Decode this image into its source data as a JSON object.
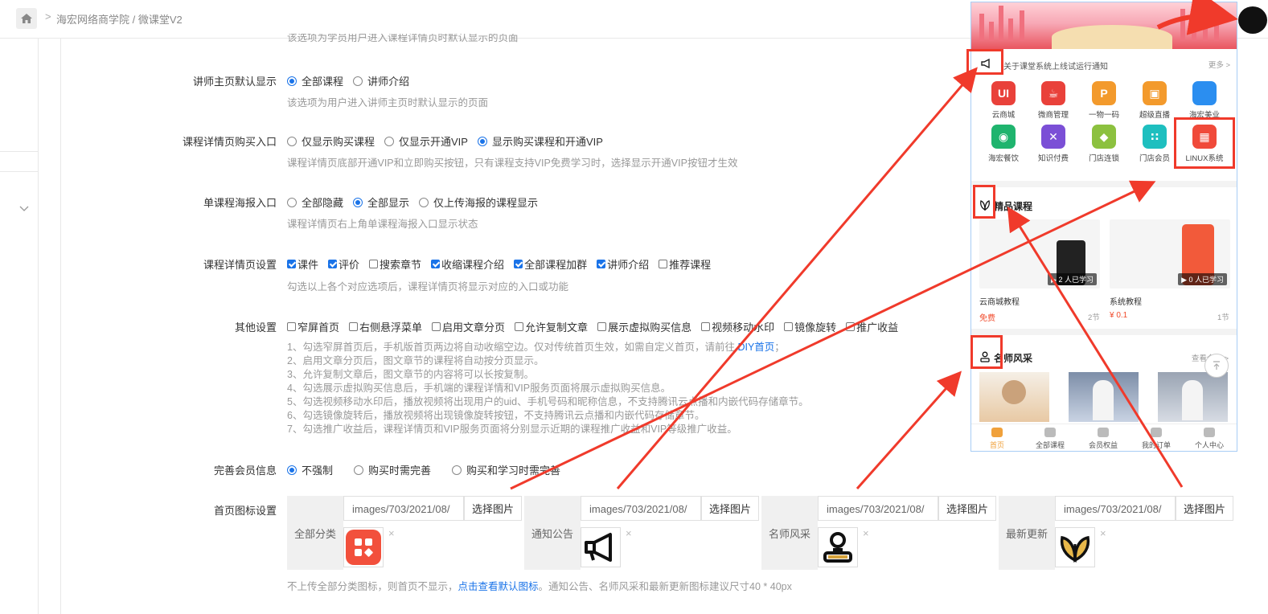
{
  "breadcrumb": "海宏网络商学院 / 微课堂V2",
  "top_hint": "该选项为学员用户进入课程详情页时默认显示的页面",
  "teacher_home": {
    "label": "讲师主页默认显示",
    "options": [
      "全部课程",
      "讲师介绍"
    ],
    "selected": 0,
    "hint": "该选项为用户进入讲师主页时默认显示的页面"
  },
  "buy_entry": {
    "label": "课程详情页购买入口",
    "options": [
      "仅显示购买课程",
      "仅显示开通VIP",
      "显示购买课程和开通VIP"
    ],
    "selected": 2,
    "hint": "课程详情页底部开通VIP和立即购买按钮，只有课程支持VIP免费学习时，选择显示开通VIP按钮才生效"
  },
  "poster_entry": {
    "label": "单课程海报入口",
    "options": [
      "全部隐藏",
      "全部显示",
      "仅上传海报的课程显示"
    ],
    "selected": 1,
    "hint": "课程详情页右上角单课程海报入口显示状态"
  },
  "detail_settings": {
    "label": "课程详情页设置",
    "options": [
      {
        "text": "课件",
        "checked": true
      },
      {
        "text": "评价",
        "checked": true
      },
      {
        "text": "搜索章节",
        "checked": false
      },
      {
        "text": "收缩课程介绍",
        "checked": true
      },
      {
        "text": "全部课程加群",
        "checked": true
      },
      {
        "text": "讲师介绍",
        "checked": true
      },
      {
        "text": "推荐课程",
        "checked": false
      }
    ],
    "hint": "勾选以上各个对应选项后，课程详情页将显示对应的入口或功能"
  },
  "other_settings": {
    "label": "其他设置",
    "options": [
      {
        "text": "窄屏首页",
        "checked": false
      },
      {
        "text": "右侧悬浮菜单",
        "checked": false
      },
      {
        "text": "启用文章分页",
        "checked": false
      },
      {
        "text": "允许复制文章",
        "checked": false
      },
      {
        "text": "展示虚拟购买信息",
        "checked": false
      },
      {
        "text": "视频移动水印",
        "checked": false
      },
      {
        "text": "镜像旋转",
        "checked": false
      },
      {
        "text": "推广收益",
        "checked": false
      }
    ],
    "hint_line1_prefix": "1、勾选窄屏首页后，手机版首页两边将自动收缩空边。仅对传统首页生效，如需自定义首页，请前往 ",
    "hint_line1_link": "DIY首页",
    "hint_line1_suffix": "；",
    "hints": [
      "2、启用文章分页后，图文章节的课程将自动按分页显示。",
      "3、允许复制文章后，图文章节的内容将可以长按复制。",
      "4、勾选展示虚拟购买信息后，手机端的课程详情和VIP服务页面将展示虚拟购买信息。",
      "5、勾选视频移动水印后，播放视频将出现用户的uid、手机号码和昵称信息，不支持腾讯云点播和内嵌代码存储章节。",
      "6、勾选镜像旋转后，播放视频将出现镜像旋转按钮，不支持腾讯云点播和内嵌代码存储章节。",
      "7、勾选推广收益后，课程详情页和VIP服务页面将分别显示近期的课程推广收益和VIP等级推广收益。"
    ]
  },
  "member_info": {
    "label": "完善会员信息",
    "options": [
      "不强制",
      "购买时需完善",
      "购买和学习时需完善"
    ],
    "selected": 0
  },
  "home_icons": {
    "label": "首页图标设置",
    "groups": [
      {
        "name": "全部分类",
        "path": "images/703/2021/08/",
        "button": "选择图片",
        "icon": "grid-category-icon"
      },
      {
        "name": "通知公告",
        "path": "images/703/2021/08/",
        "button": "选择图片",
        "icon": "megaphone-icon"
      },
      {
        "name": "名师风采",
        "path": "images/703/2021/08/",
        "button": "选择图片",
        "icon": "teacher-icon"
      },
      {
        "name": "最新更新",
        "path": "images/703/2021/08/",
        "button": "选择图片",
        "icon": "leaf-icon"
      }
    ],
    "remove": "×",
    "hint_prefix": "不上传全部分类图标，则首页不显示，",
    "hint_link": "点击查看默认图标",
    "hint_suffix": "。通知公告、名师风采和最新更新图标建议尺寸40 * 40px"
  },
  "phone": {
    "notice_text": "关于课堂系统上线试运行通知",
    "more": "更多 >",
    "apps": [
      {
        "label": "云商城",
        "color": "#e9413a",
        "glyph": "UI"
      },
      {
        "label": "微商管理",
        "color": "#e9413a",
        "glyph": "☕"
      },
      {
        "label": "一物一码",
        "color": "#f39a2c",
        "glyph": "P"
      },
      {
        "label": "超级直播",
        "color": "#f39a2c",
        "glyph": "▣"
      },
      {
        "label": "海宏美业",
        "color": "#2b8ef0",
        "glyph": ""
      },
      {
        "label": "海宏餐饮",
        "color": "#1fb46e",
        "glyph": "◉"
      },
      {
        "label": "知识付费",
        "color": "#7b4fd6",
        "glyph": "✕"
      },
      {
        "label": "门店连锁",
        "color": "#8cc13f",
        "glyph": "◆"
      },
      {
        "label": "门店会员",
        "color": "#1ebfbf",
        "glyph": "∷"
      },
      {
        "label": "LINUX系统",
        "color": "#f04a3a",
        "glyph": "▦"
      }
    ],
    "featured_title": "精品课程",
    "courses": [
      {
        "name": "云商城教程",
        "price": "免费",
        "count": "2节",
        "badge": "▶ 2 人已学习"
      },
      {
        "name": "系统教程",
        "price": "¥ 0.1",
        "count": "1节",
        "badge": "▶ 0 人已学习"
      }
    ],
    "teachers_title": "名师风采",
    "teachers_more": "查看全部 >",
    "tabs": [
      "首页",
      "全部课程",
      "会员权益",
      "我的订单",
      "个人中心"
    ]
  }
}
